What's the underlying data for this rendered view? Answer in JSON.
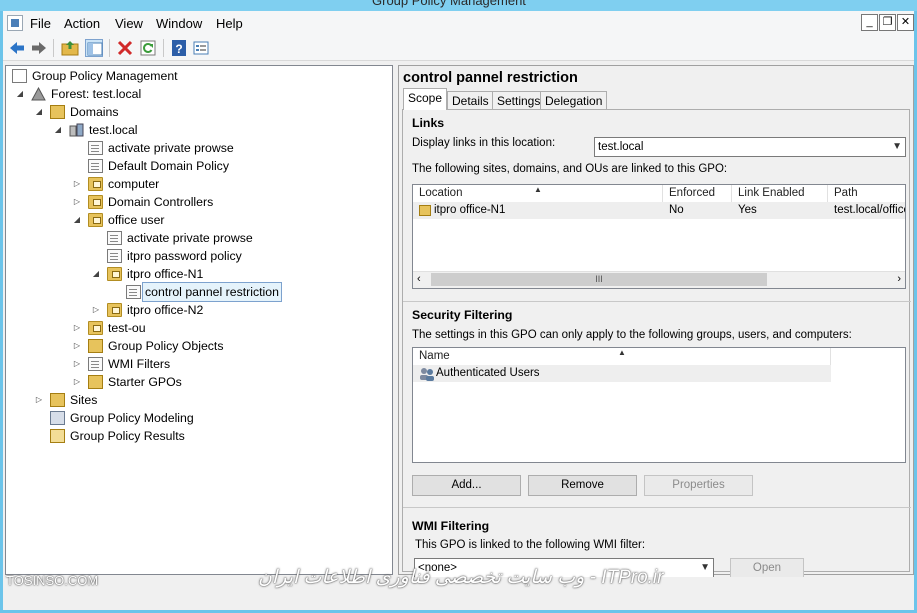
{
  "window": {
    "title": "Group Policy Management"
  },
  "menu": [
    "File",
    "Action",
    "View",
    "Window",
    "Help"
  ],
  "mdi": {
    "minimize": "_",
    "restore": "❐",
    "close": "✕"
  },
  "toolbar": [
    {
      "name": "back-icon",
      "color": "#2b74c7"
    },
    {
      "name": "forward-icon",
      "color": "#555555"
    },
    {
      "name": "up-folder-icon",
      "color": "#d3a52b"
    },
    {
      "name": "show-hide-tree-icon",
      "color": "#4a7fb5"
    },
    {
      "name": "delete-icon",
      "color": "#d12a2a"
    },
    {
      "name": "refresh-icon",
      "color": "#3b9c3b"
    },
    {
      "name": "help-icon",
      "color": "#2c5ea8"
    },
    {
      "name": "properties-icon",
      "color": "#4a7fb5"
    }
  ],
  "tree": [
    {
      "label": "Group Policy Management",
      "icon": "gpm-icon",
      "expand": ""
    },
    {
      "label": "Forest: test.local",
      "icon": "forest-icon",
      "expand": "◢"
    },
    {
      "label": "Domains",
      "icon": "domains-icon",
      "expand": "◢"
    },
    {
      "label": "test.local",
      "icon": "domain-icon",
      "expand": "◢"
    },
    {
      "label": "activate private prowse",
      "icon": "gpo-link-icon",
      "expand": ""
    },
    {
      "label": "Default Domain Policy",
      "icon": "gpo-link-icon",
      "expand": ""
    },
    {
      "label": "computer",
      "icon": "ou-icon",
      "expand": "▷"
    },
    {
      "label": "Domain Controllers",
      "icon": "ou-icon",
      "expand": "▷"
    },
    {
      "label": "office user",
      "icon": "ou-icon",
      "expand": "◢"
    },
    {
      "label": "activate private prowse",
      "icon": "gpo-link-icon",
      "expand": ""
    },
    {
      "label": "itpro password policy",
      "icon": "gpo-link-icon",
      "expand": ""
    },
    {
      "label": "itpro office-N1",
      "icon": "ou-icon",
      "expand": "◢"
    },
    {
      "label": "control pannel restriction",
      "icon": "gpo-link-icon",
      "expand": "",
      "selected": true
    },
    {
      "label": "itpro office-N2",
      "icon": "ou-icon",
      "expand": "▷"
    },
    {
      "label": "test-ou",
      "icon": "ou-icon",
      "expand": "▷"
    },
    {
      "label": "Group Policy Objects",
      "icon": "gpo-container-icon",
      "expand": "▷"
    },
    {
      "label": "WMI Filters",
      "icon": "wmi-filters-icon",
      "expand": "▷"
    },
    {
      "label": "Starter GPOs",
      "icon": "starter-gpos-icon",
      "expand": "▷"
    },
    {
      "label": "Sites",
      "icon": "sites-icon",
      "expand": "▷"
    },
    {
      "label": "Group Policy Modeling",
      "icon": "modeling-icon",
      "expand": ""
    },
    {
      "label": "Group Policy Results",
      "icon": "results-icon",
      "expand": ""
    }
  ],
  "detail": {
    "title": "control pannel restriction",
    "tabs": [
      "Scope",
      "Details",
      "Settings",
      "Delegation"
    ],
    "links": {
      "heading": "Links",
      "display_label": "Display links in this location:",
      "display_value": "test.local",
      "info": "The following sites, domains, and OUs are linked to this GPO:",
      "columns": [
        "Location",
        "Enforced",
        "Link Enabled",
        "Path"
      ],
      "rows": [
        [
          "itpro office-N1",
          "No",
          "Yes",
          "test.local/office"
        ]
      ],
      "scroll_thumb": "III"
    },
    "security": {
      "heading": "Security Filtering",
      "info": "The settings in this GPO can only apply to the following groups, users, and computers:",
      "columns": [
        "Name"
      ],
      "rows": [
        "Authenticated Users"
      ],
      "buttons": {
        "add": "Add...",
        "remove": "Remove",
        "properties": "Properties"
      }
    },
    "wmi": {
      "heading": "WMI Filtering",
      "info": "This GPO is linked to the following WMI filter:",
      "value": "<none>",
      "open": "Open"
    }
  },
  "watermark": {
    "left": "TOSINSO.COM",
    "right": "ITPro.ir - وب سایت تخصصی فناوری اطلاعات ایران"
  }
}
